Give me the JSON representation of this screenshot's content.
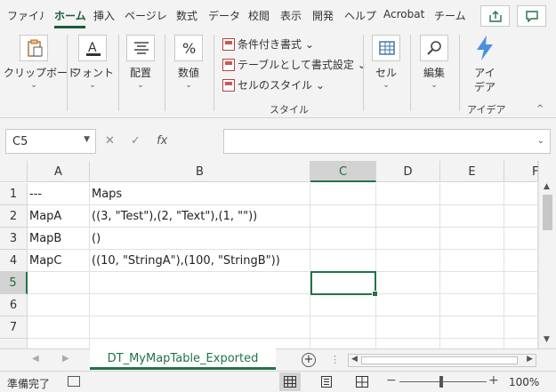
{
  "ribbon_tabs": [
    "ファイル",
    "ホーム",
    "挿入",
    "ページレ",
    "数式",
    "データ",
    "校閲",
    "表示",
    "開発",
    "ヘルプ",
    "Acrobat",
    "チーム"
  ],
  "active_tab": "ホーム",
  "ribbon": {
    "clipboard": "クリップボード",
    "font": "フォント",
    "alignment": "配置",
    "number": "数値",
    "conditional_format": "条件付き書式",
    "format_as_table": "テーブルとして書式設定",
    "cell_styles": "セルのスタイル",
    "styles_group": "スタイル",
    "cells": "セル",
    "editing": "編集",
    "ideas_line1": "アイ",
    "ideas_line2": "デア",
    "ideas_group": "アイデア",
    "dropdown": "⌄",
    "collapse": "^"
  },
  "formula_bar": {
    "name_box": "C5",
    "cancel": "✕",
    "enter": "✓",
    "fx": "fx",
    "value": ""
  },
  "columns": [
    "A",
    "B",
    "C",
    "D",
    "E",
    "F"
  ],
  "rows": [
    "1",
    "2",
    "3",
    "4",
    "5",
    "6",
    "7"
  ],
  "cells": {
    "A1": "---",
    "B1": "Maps",
    "A2": "MapA",
    "B2": "((3, \"Test\"),(2, \"Text\"),(1, \"\"))",
    "A3": "MapB",
    "B3": "()",
    "A4": "MapC",
    "B4": "((10, \"StringA\"),(100, \"StringB\"))"
  },
  "active_cell": "C5",
  "sheet_tab": "DT_MyMapTable_Exported",
  "status": {
    "ready": "準備完了",
    "zoom": "100%",
    "minus": "−",
    "plus": "+"
  },
  "colors": {
    "accent": "#217346",
    "active_tab": "#185c37"
  }
}
